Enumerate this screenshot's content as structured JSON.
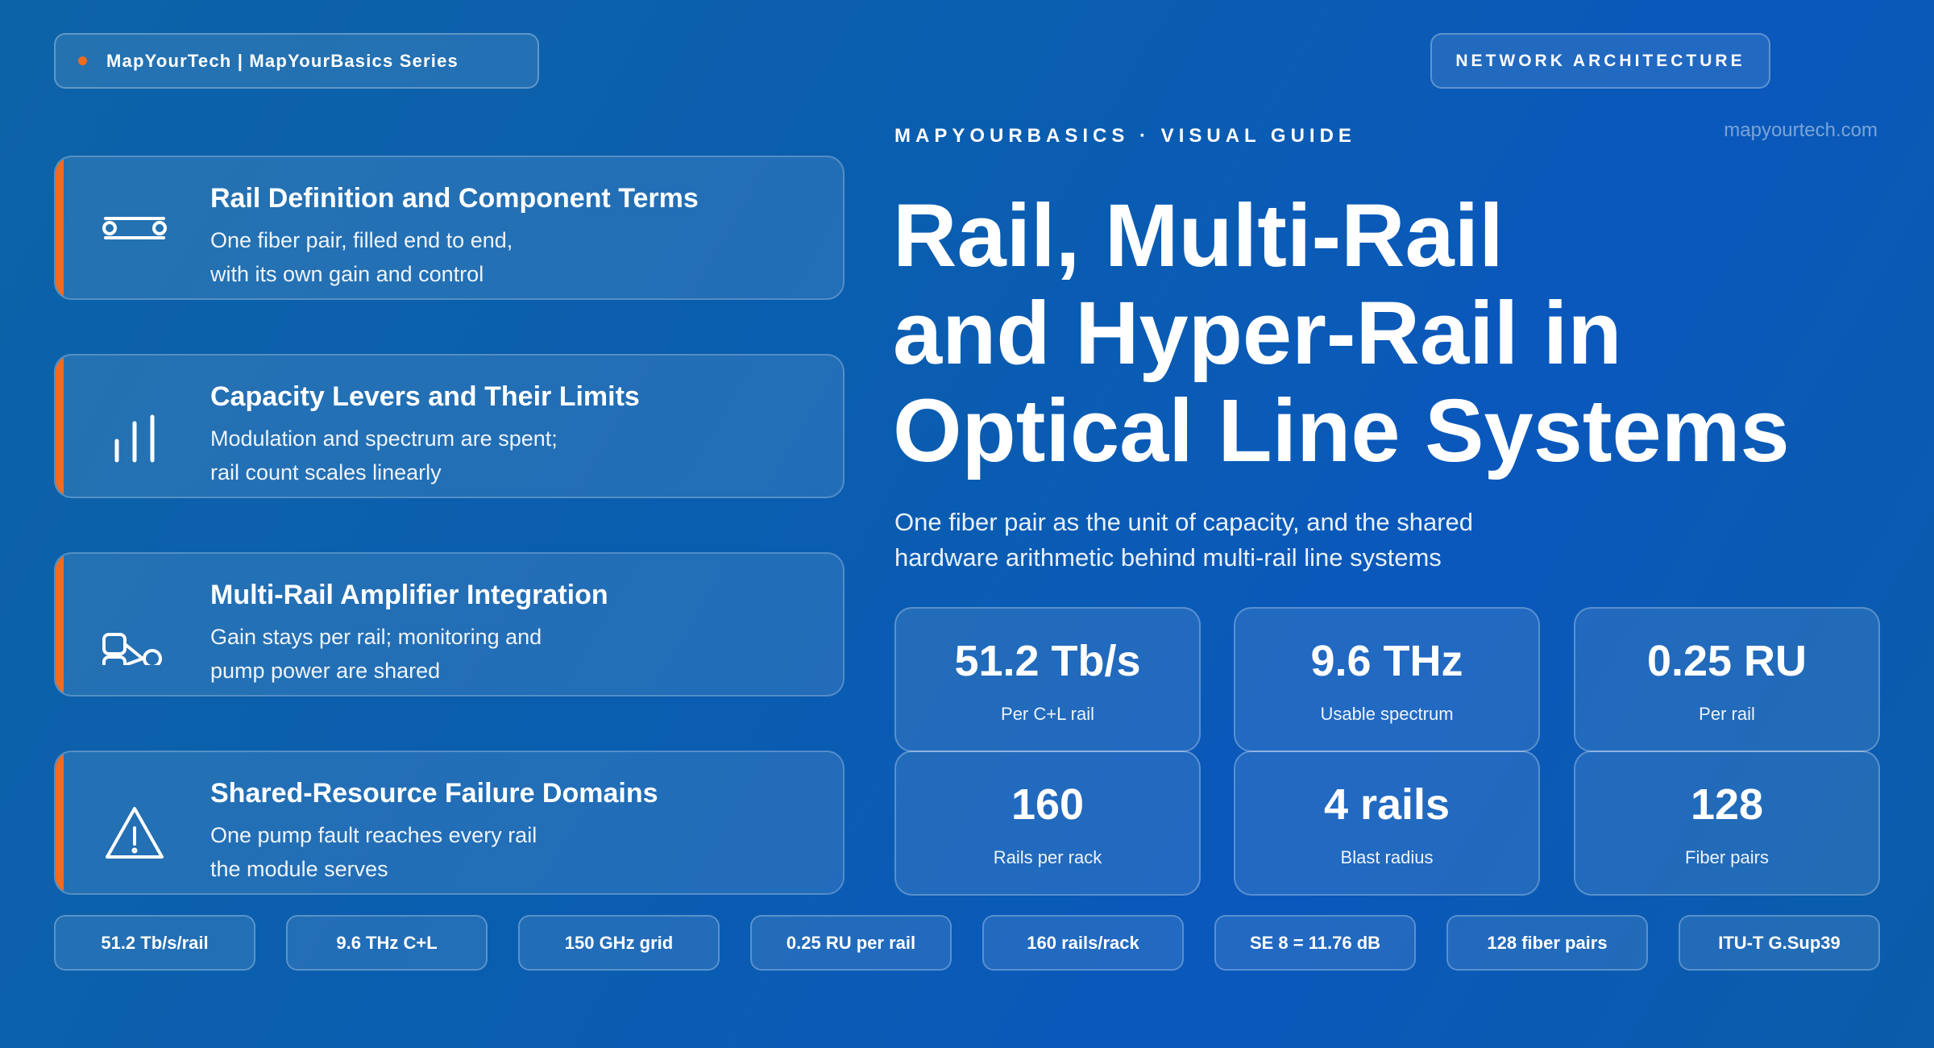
{
  "brand": {
    "label": "MapYourTech | MapYourBasics Series"
  },
  "category": {
    "label": "NETWORK ARCHITECTURE"
  },
  "domain": "mapyourtech.com",
  "hero": {
    "eyebrow": "MAPYOURBASICS · VISUAL GUIDE",
    "title_lines": [
      "Rail, Multi-Rail",
      "and Hyper-Rail in",
      "Optical Line Systems"
    ],
    "subtitle_lines": [
      "One fiber pair as the unit of capacity, and the shared",
      "hardware arithmetic behind multi-rail line systems"
    ]
  },
  "topics": [
    {
      "icon": "rail-icon",
      "title": "Rail Definition and Component Terms",
      "lines": [
        "One fiber pair, filled end to end,",
        "with its own gain and control"
      ]
    },
    {
      "icon": "bar-levels-icon",
      "title": "Capacity Levers and Their Limits",
      "lines": [
        "Modulation and spectrum are spent;",
        "rail count scales linearly"
      ]
    },
    {
      "icon": "amplifier-integration-icon",
      "title": "Multi-Rail Amplifier Integration",
      "lines": [
        "Gain stays per rail; monitoring and",
        "pump power are shared"
      ]
    },
    {
      "icon": "warning-icon",
      "title": "Shared-Resource Failure Domains",
      "lines": [
        "One pump fault reaches every rail",
        "the module serves"
      ]
    }
  ],
  "stats": [
    {
      "value": "51.2 Tb/s",
      "label": "Per C+L rail"
    },
    {
      "value": "9.6 THz",
      "label": "Usable spectrum"
    },
    {
      "value": "0.25 RU",
      "label": "Per rail"
    },
    {
      "value": "160",
      "label": "Rails per rack"
    },
    {
      "value": "4 rails",
      "label": "Blast radius"
    },
    {
      "value": "128",
      "label": "Fiber pairs"
    }
  ],
  "chips": [
    "51.2 Tb/s/rail",
    "9.6 THz C+L",
    "150 GHz grid",
    "0.25 RU per rail",
    "160 rails/rack",
    "SE 8 = 11.76 dB",
    "128 fiber pairs",
    "ITU-T G.Sup39"
  ],
  "colors": {
    "accent": "#f26b1f",
    "background": "#0a5db0"
  }
}
